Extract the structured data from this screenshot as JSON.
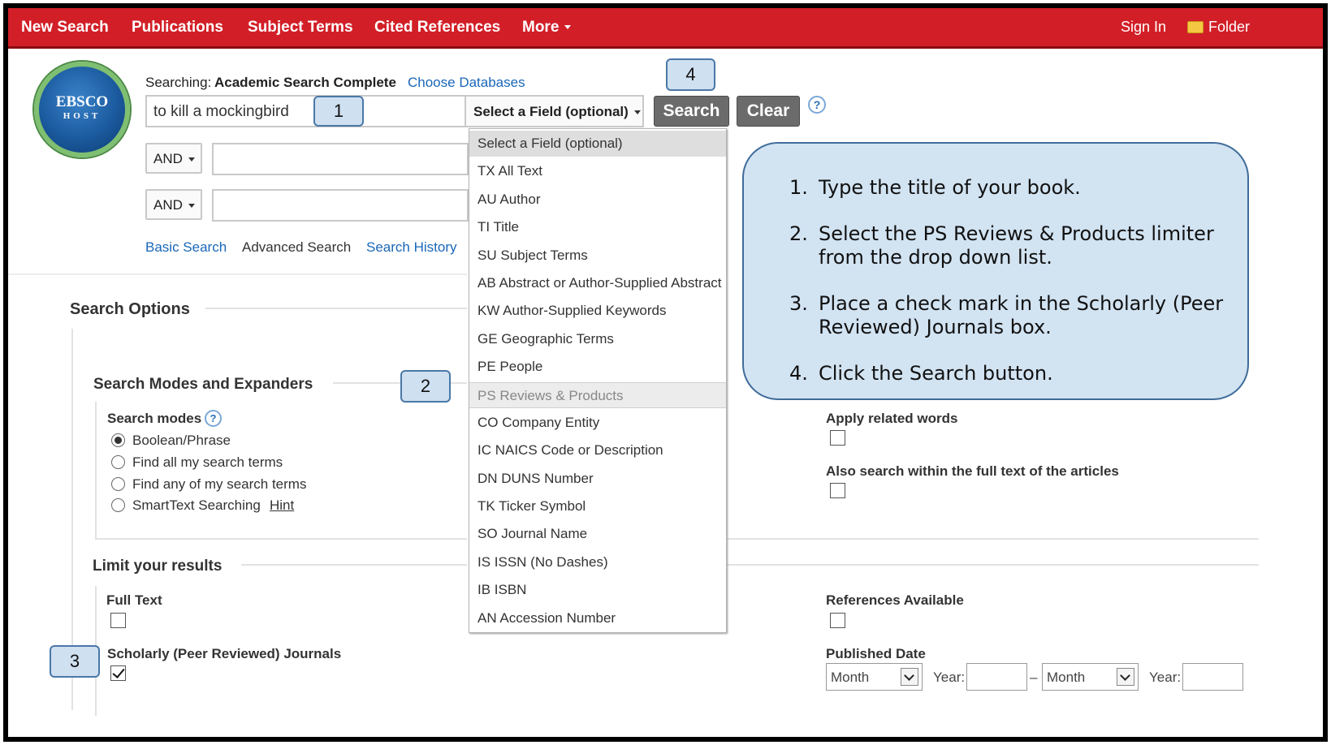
{
  "nav": {
    "items": [
      "New Search",
      "Publications",
      "Subject Terms",
      "Cited References",
      "More"
    ],
    "sign_in": "Sign In",
    "folder": "Folder",
    "accent": "#d21f27"
  },
  "logo": {
    "top": "EBSCO",
    "bottom": "HOST"
  },
  "search": {
    "searching_label": "Searching:",
    "database": "Academic Search Complete",
    "choose_databases": "Choose Databases",
    "query": "to kill a mockingbird",
    "field_select": "Select a Field (optional)",
    "search_button": "Search",
    "clear_button": "Clear",
    "help": "?",
    "bool1": "AND",
    "bool2": "AND",
    "links": [
      "Basic Search",
      "Advanced Search",
      "Search History"
    ]
  },
  "callouts": [
    "1",
    "2",
    "3",
    "4"
  ],
  "dropdown": {
    "items": [
      "Select a Field (optional)",
      "TX All Text",
      "AU Author",
      "TI Title",
      "SU Subject Terms",
      "AB Abstract or Author-Supplied Abstract",
      "KW Author-Supplied Keywords",
      "GE Geographic Terms",
      "PE People",
      "PS Reviews & Products",
      "CO Company Entity",
      "IC NAICS Code or Description",
      "DN DUNS Number",
      "TK Ticker Symbol",
      "SO Journal Name",
      "IS ISSN (No Dashes)",
      "IB ISBN",
      "AN Accession Number"
    ]
  },
  "options": {
    "search_options": "Search Options",
    "modes_section": "Search Modes and Expanders",
    "search_modes_label": "Search modes",
    "modes": [
      "Boolean/Phrase",
      "Find all my search terms",
      "Find any of my search terms",
      "SmartText Searching"
    ],
    "hint": "Hint",
    "apply_related": "Apply related words",
    "also_fulltext": "Also search within the full text of the articles",
    "limit_section": "Limit your results",
    "full_text": "Full Text",
    "scholarly": "Scholarly (Peer Reviewed) Journals",
    "references_available": "References Available",
    "published_date": "Published Date",
    "month1": "Month",
    "month2": "Month",
    "year1": "Year:",
    "year2": "Year:",
    "dash": "–"
  },
  "instructions": [
    {
      "num": "1.",
      "text": "Type the title of your book."
    },
    {
      "num": "2.",
      "text": "Select the PS Reviews & Products limiter from the drop down list."
    },
    {
      "num": "3.",
      "text": "Place a check mark in the Scholarly (Peer Reviewed) Journals box."
    },
    {
      "num": "4.",
      "text": "Click the Search button."
    }
  ]
}
